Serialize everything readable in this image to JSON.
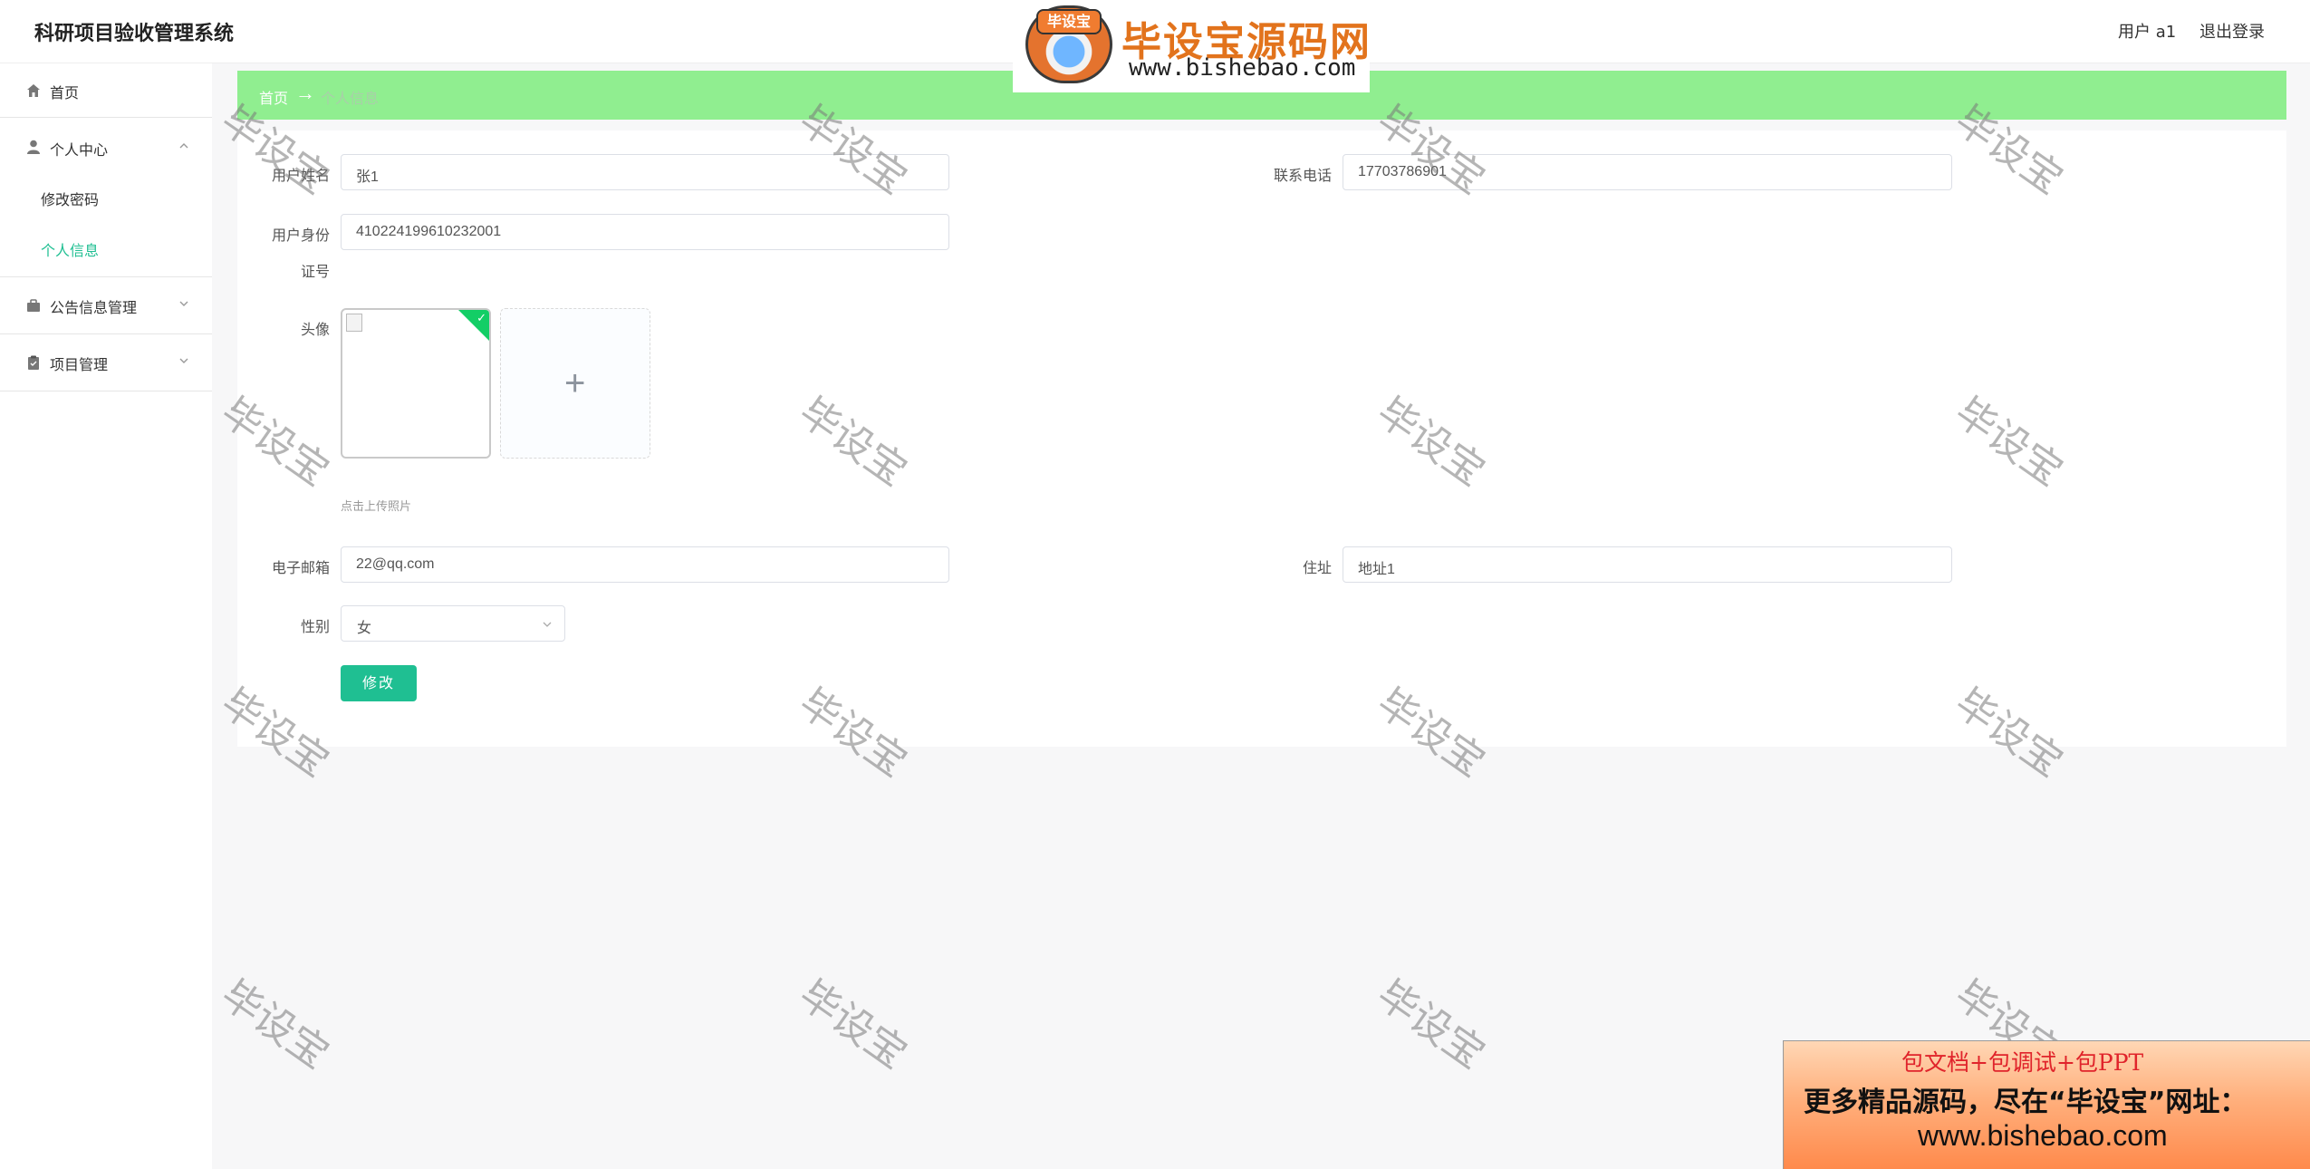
{
  "header": {
    "app_title": "科研项目验收管理系统",
    "user_label": "用户 a1",
    "logout_label": "退出登录"
  },
  "brand": {
    "badge_text": "毕设宝",
    "name": "毕设宝源码网",
    "url": "www.bishebao.com"
  },
  "sidebar": {
    "items": [
      {
        "label": "首页",
        "icon": "home-icon"
      },
      {
        "label": "个人中心",
        "icon": "user-icon"
      },
      {
        "label": "修改密码"
      },
      {
        "label": "个人信息"
      },
      {
        "label": "公告信息管理",
        "icon": "briefcase-icon"
      },
      {
        "label": "项目管理",
        "icon": "clipboard-icon"
      }
    ]
  },
  "breadcrumb": {
    "home": "首页",
    "separator": "→",
    "current": "个人信息"
  },
  "form": {
    "name_label": "用户姓名",
    "name_value": "张1",
    "phone_label": "联系电话",
    "phone_value": "17703786901",
    "idcard_label_1": "用户身份",
    "idcard_label_2": "证号",
    "idcard_value": "410224199610232001",
    "avatar_label": "头像",
    "upload_plus": "+",
    "upload_hint": "点击上传照片",
    "email_label": "电子邮箱",
    "email_value": "22@qq.com",
    "address_label": "住址",
    "address_value": "地址1",
    "gender_label": "性别",
    "gender_value": "女",
    "submit_label": "修改"
  },
  "watermark": {
    "text": "毕设宝"
  },
  "ad": {
    "line1": "包文档+包调试+包PPT",
    "line2": "更多精品源码，尽在“毕设宝”网址：",
    "line3": "www.bishebao.com"
  },
  "colors": {
    "accent": "#1fbf92",
    "breadcrumb_bg": "#90ee90",
    "avatar_corner": "#13ce66"
  }
}
